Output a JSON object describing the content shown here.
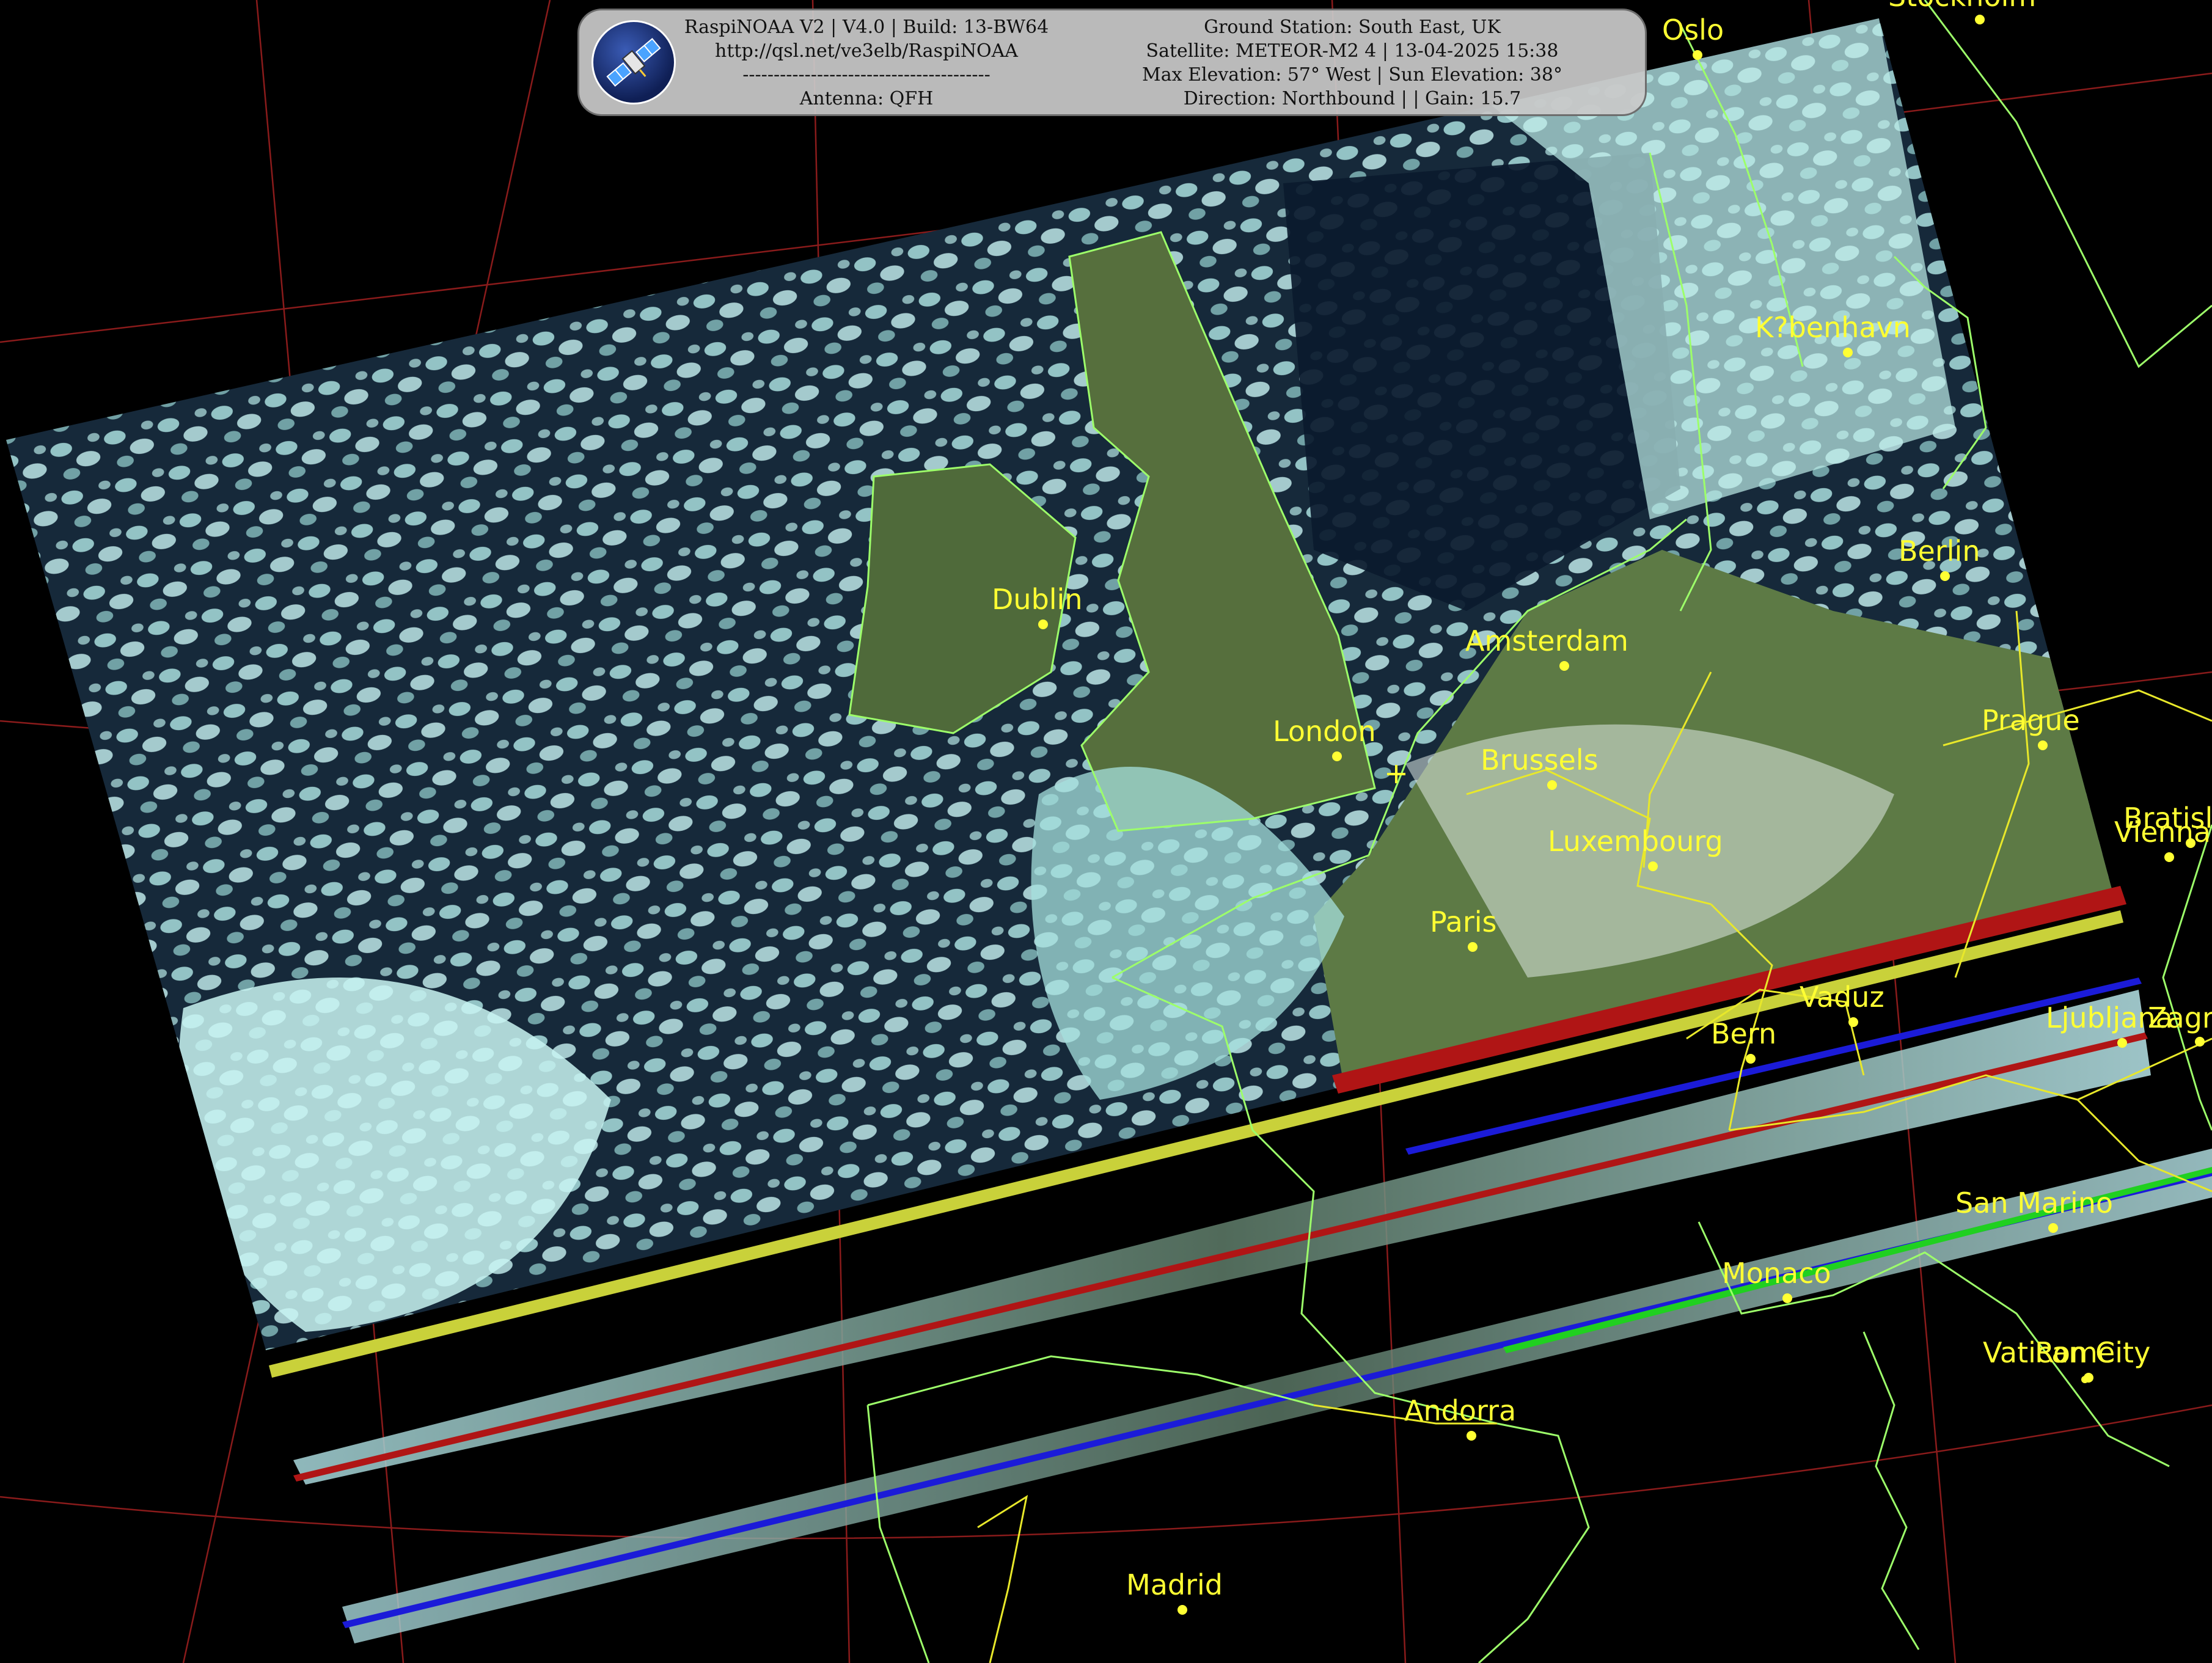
{
  "header": {
    "left_lines": [
      "RaspiNOAA V2 | V4.0 | Build: 13-BW64",
      "http://qsl.net/ve3elb/RaspiNOAA",
      "----------------------------------------",
      "Antenna: QFH"
    ],
    "right_lines": [
      "Ground Station: South East, UK",
      "Satellite: METEOR-M2 4 | 13-04-2025 15:38",
      "Max Elevation: 57° West | Sun Elevation: 38°",
      "Direction: Northbound | | Gain: 15.7"
    ],
    "logo_icon": "satellite-icon"
  },
  "cities": [
    {
      "name": "Stockholm"
    },
    {
      "name": "Oslo"
    },
    {
      "name": "K?benhavn"
    },
    {
      "name": "Berlin"
    },
    {
      "name": "Dublin"
    },
    {
      "name": "Amsterdam"
    },
    {
      "name": "London"
    },
    {
      "name": "Brussels"
    },
    {
      "name": "Luxembourg"
    },
    {
      "name": "Prague"
    },
    {
      "name": "Bratislava"
    },
    {
      "name": "Vienna"
    },
    {
      "name": "Paris"
    },
    {
      "name": "Vaduz"
    },
    {
      "name": "Bern"
    },
    {
      "name": "Ljubljana"
    },
    {
      "name": "Zagreb"
    },
    {
      "name": "San Marino"
    },
    {
      "name": "Monaco"
    },
    {
      "name": "Vatican City"
    },
    {
      "name": "Rome"
    },
    {
      "name": "Andorra"
    },
    {
      "name": "Madrid"
    }
  ],
  "colors": {
    "background": "#000000",
    "graticule": "#8a1b1b",
    "coastline": "#9dff6a",
    "border": "#e8e82a",
    "city_label": "#ffff33",
    "cloud": "#bff2f0",
    "ocean": "#0b1a2e",
    "land": "#4f6a3a"
  }
}
